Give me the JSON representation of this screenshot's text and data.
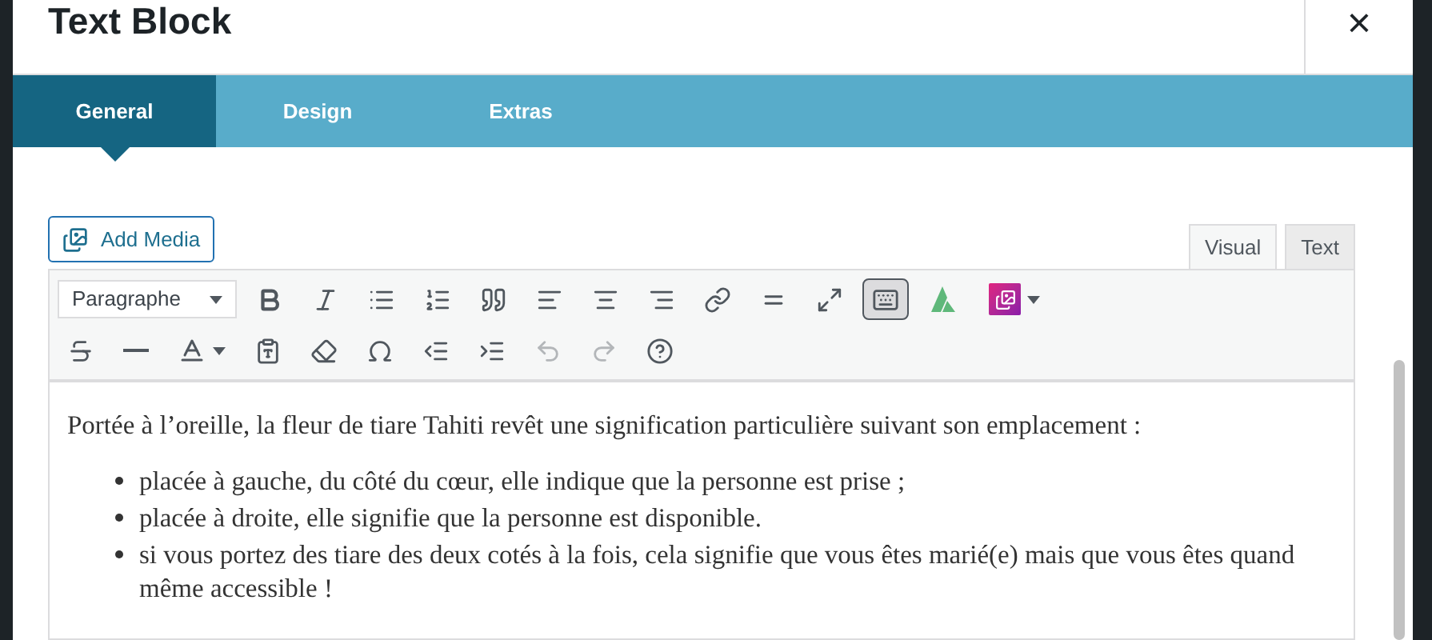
{
  "dialog": {
    "title": "Text Block",
    "close_label": "×"
  },
  "tabs": [
    {
      "label": "General",
      "selected": true
    },
    {
      "label": "Design",
      "selected": false
    },
    {
      "label": "Extras",
      "selected": false
    }
  ],
  "add_media": {
    "label": "Add Media"
  },
  "editor_tabs": [
    {
      "label": "Visual",
      "selected": true
    },
    {
      "label": "Text",
      "selected": false
    }
  ],
  "format_select": {
    "value": "Paragraphe"
  },
  "toolbar_rows": [
    [
      {
        "kind": "bold",
        "pressed": false,
        "disabled": false
      },
      {
        "kind": "italic",
        "pressed": false,
        "disabled": false
      },
      {
        "kind": "bullets",
        "pressed": false,
        "disabled": false
      },
      {
        "kind": "numbers",
        "pressed": false,
        "disabled": false
      },
      {
        "kind": "quote",
        "pressed": false,
        "disabled": false
      },
      {
        "kind": "align-left",
        "pressed": false,
        "disabled": false
      },
      {
        "kind": "align-center",
        "pressed": false,
        "disabled": false
      },
      {
        "kind": "align-right",
        "pressed": false,
        "disabled": false
      },
      {
        "kind": "link",
        "pressed": false,
        "disabled": false
      },
      {
        "kind": "more",
        "pressed": false,
        "disabled": false
      },
      {
        "kind": "fullscreen",
        "pressed": false,
        "disabled": false
      },
      {
        "kind": "toolbar",
        "pressed": true,
        "disabled": false
      },
      {
        "kind": "logo",
        "pressed": false,
        "disabled": false
      },
      {
        "kind": "gallery",
        "pressed": false,
        "disabled": false
      }
    ],
    [
      {
        "kind": "strike",
        "pressed": false,
        "disabled": false
      },
      {
        "kind": "hr",
        "pressed": false,
        "disabled": false
      },
      {
        "kind": "color",
        "pressed": false,
        "disabled": false
      },
      {
        "kind": "paste",
        "pressed": false,
        "disabled": false
      },
      {
        "kind": "eraser",
        "pressed": false,
        "disabled": false
      },
      {
        "kind": "omega",
        "pressed": false,
        "disabled": false
      },
      {
        "kind": "outdent",
        "pressed": false,
        "disabled": false
      },
      {
        "kind": "indent",
        "pressed": false,
        "disabled": false
      },
      {
        "kind": "undo",
        "pressed": false,
        "disabled": true
      },
      {
        "kind": "redo",
        "pressed": false,
        "disabled": true
      },
      {
        "kind": "help",
        "pressed": false,
        "disabled": false
      }
    ]
  ],
  "content": {
    "paragraph": "Portée à l’oreille, la fleur de tiare Tahiti revêt une signification particulière suivant son emplacement :",
    "bullets": [
      "placée à gauche, du côté du cœur, elle indique que la personne est prise ;",
      "placée à droite, elle signifie que la personne est disponible.",
      "si vous portez des tiare des deux cotés à la fois, cela signifie que vous êtes marié(e) mais que vous êtes quand même accessible !"
    ]
  }
}
